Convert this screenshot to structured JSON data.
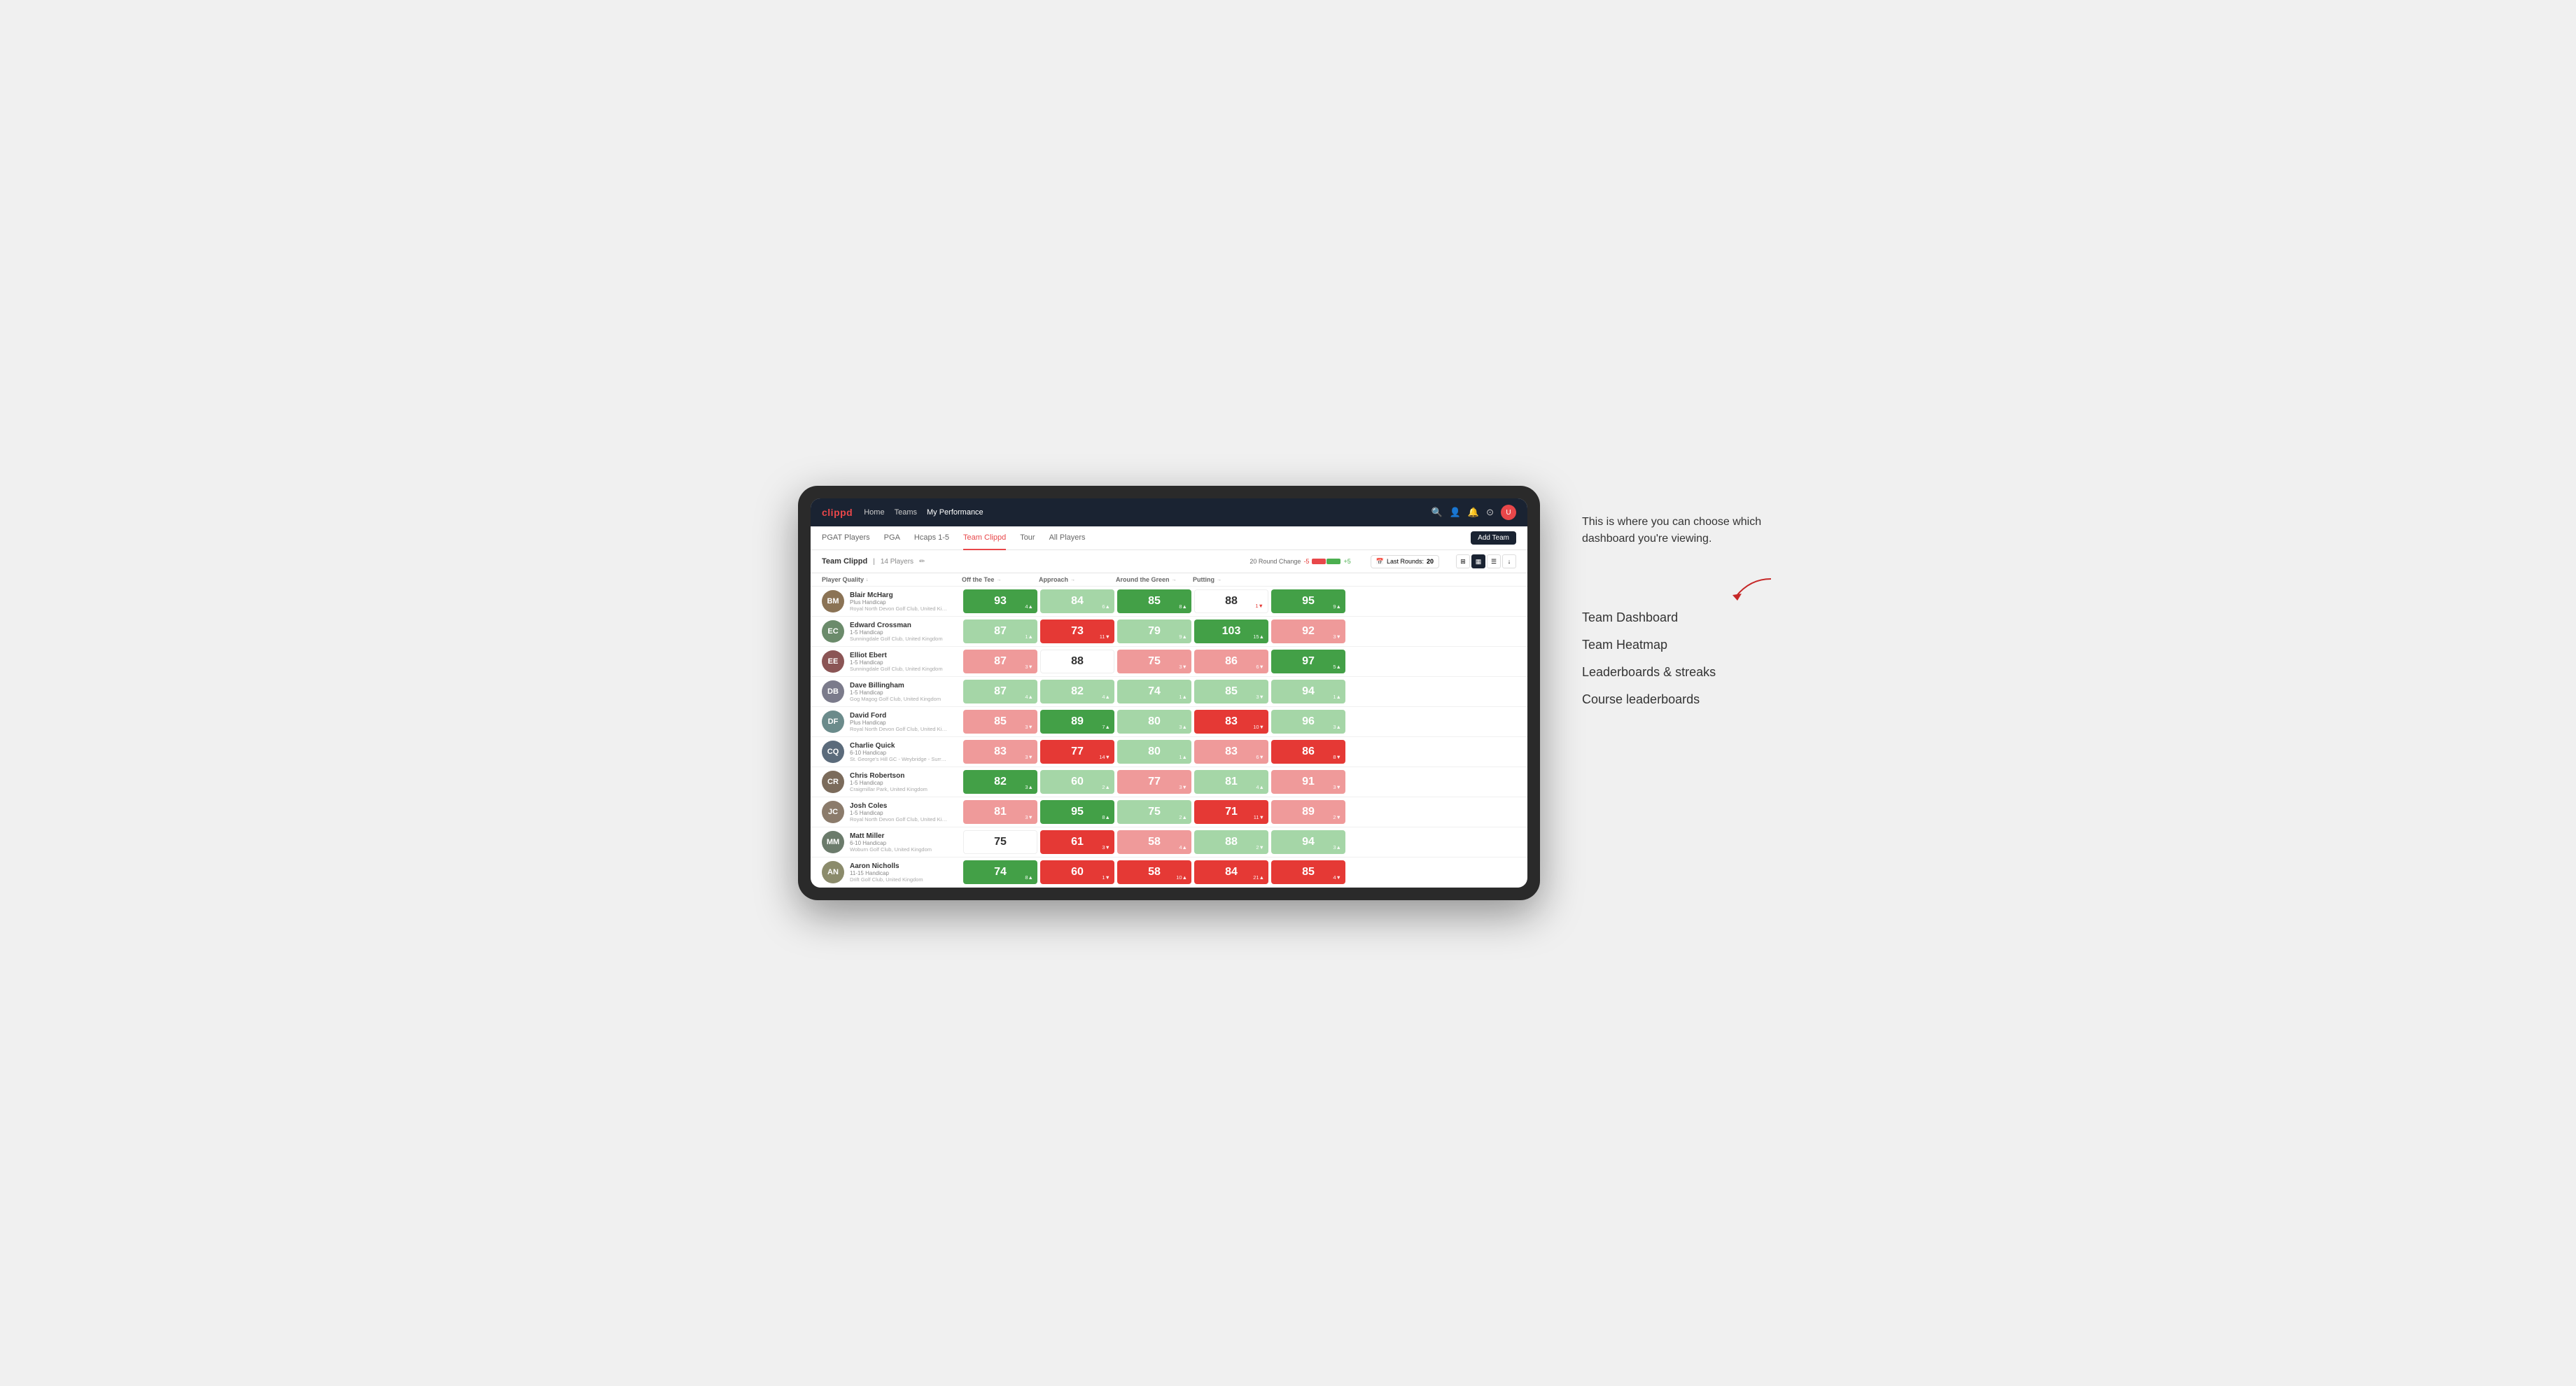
{
  "annotation": {
    "intro_text": "This is where you can choose which dashboard you're viewing.",
    "menu_items": [
      "Team Dashboard",
      "Team Heatmap",
      "Leaderboards & streaks",
      "Course leaderboards"
    ]
  },
  "nav": {
    "logo": "clippd",
    "links": [
      "Home",
      "Teams",
      "My Performance"
    ],
    "active_link": "My Performance"
  },
  "sub_nav": {
    "links": [
      "PGAT Players",
      "PGA",
      "Hcaps 1-5",
      "Team Clippd",
      "Tour",
      "All Players"
    ],
    "active_link": "Team Clippd",
    "add_team_label": "Add Team"
  },
  "team_bar": {
    "name": "Team Clippd",
    "count": "14 Players",
    "round_change_label": "20 Round Change",
    "change_neg": "-5",
    "change_pos": "+5",
    "last_rounds_label": "Last Rounds:",
    "last_rounds_value": "20"
  },
  "table": {
    "headers": [
      "Player Quality ↓",
      "Off the Tee →",
      "Approach →",
      "Around the Green →",
      "Putting →"
    ],
    "rows": [
      {
        "name": "Blair McHarg",
        "handicap": "Plus Handicap",
        "club": "Royal North Devon Golf Club, United Kingdom",
        "initials": "BM",
        "color": "#8B7355",
        "scores": [
          {
            "value": "93",
            "change": "4▲",
            "bg": "green-dark",
            "text": "colored",
            "change_dir": "up"
          },
          {
            "value": "84",
            "change": "6▲",
            "bg": "green-light",
            "text": "colored",
            "change_dir": "up"
          },
          {
            "value": "85",
            "change": "8▲",
            "bg": "green-dark",
            "text": "colored",
            "change_dir": "up"
          },
          {
            "value": "88",
            "change": "1▼",
            "bg": "white",
            "text": "white",
            "change_dir": "down"
          },
          {
            "value": "95",
            "change": "9▲",
            "bg": "green-dark",
            "text": "colored",
            "change_dir": "up"
          }
        ]
      },
      {
        "name": "Edward Crossman",
        "handicap": "1-5 Handicap",
        "club": "Sunningdale Golf Club, United Kingdom",
        "initials": "EC",
        "color": "#6B8B6B",
        "scores": [
          {
            "value": "87",
            "change": "1▲",
            "bg": "green-light",
            "text": "colored",
            "change_dir": "up"
          },
          {
            "value": "73",
            "change": "11▼",
            "bg": "red-dark",
            "text": "colored",
            "change_dir": "down"
          },
          {
            "value": "79",
            "change": "9▲",
            "bg": "green-light",
            "text": "colored",
            "change_dir": "up"
          },
          {
            "value": "103",
            "change": "15▲",
            "bg": "green-dark",
            "text": "colored",
            "change_dir": "up"
          },
          {
            "value": "92",
            "change": "3▼",
            "bg": "red-light",
            "text": "colored",
            "change_dir": "down"
          }
        ]
      },
      {
        "name": "Elliot Ebert",
        "handicap": "1-5 Handicap",
        "club": "Sunningdale Golf Club, United Kingdom",
        "initials": "EE",
        "color": "#8B5555",
        "scores": [
          {
            "value": "87",
            "change": "3▼",
            "bg": "red-light",
            "text": "colored",
            "change_dir": "down"
          },
          {
            "value": "88",
            "change": "",
            "bg": "white",
            "text": "white",
            "change_dir": ""
          },
          {
            "value": "75",
            "change": "3▼",
            "bg": "red-light",
            "text": "colored",
            "change_dir": "down"
          },
          {
            "value": "86",
            "change": "6▼",
            "bg": "red-light",
            "text": "colored",
            "change_dir": "down"
          },
          {
            "value": "97",
            "change": "5▲",
            "bg": "green-dark",
            "text": "colored",
            "change_dir": "up"
          }
        ]
      },
      {
        "name": "Dave Billingham",
        "handicap": "1-5 Handicap",
        "club": "Gog Magog Golf Club, United Kingdom",
        "initials": "DB",
        "color": "#7B7B8B",
        "scores": [
          {
            "value": "87",
            "change": "4▲",
            "bg": "green-light",
            "text": "colored",
            "change_dir": "up"
          },
          {
            "value": "82",
            "change": "4▲",
            "bg": "green-light",
            "text": "colored",
            "change_dir": "up"
          },
          {
            "value": "74",
            "change": "1▲",
            "bg": "green-light",
            "text": "colored",
            "change_dir": "up"
          },
          {
            "value": "85",
            "change": "3▼",
            "bg": "green-light",
            "text": "colored",
            "change_dir": "down"
          },
          {
            "value": "94",
            "change": "1▲",
            "bg": "green-light",
            "text": "colored",
            "change_dir": "up"
          }
        ]
      },
      {
        "name": "David Ford",
        "handicap": "Plus Handicap",
        "club": "Royal North Devon Golf Club, United Kingdom",
        "initials": "DF",
        "color": "#6B8B8B",
        "scores": [
          {
            "value": "85",
            "change": "3▼",
            "bg": "red-light",
            "text": "colored",
            "change_dir": "down"
          },
          {
            "value": "89",
            "change": "7▲",
            "bg": "green-dark",
            "text": "colored",
            "change_dir": "up"
          },
          {
            "value": "80",
            "change": "3▲",
            "bg": "green-light",
            "text": "colored",
            "change_dir": "up"
          },
          {
            "value": "83",
            "change": "10▼",
            "bg": "red-dark",
            "text": "colored",
            "change_dir": "down"
          },
          {
            "value": "96",
            "change": "3▲",
            "bg": "green-light",
            "text": "colored",
            "change_dir": "up"
          }
        ]
      },
      {
        "name": "Charlie Quick",
        "handicap": "6-10 Handicap",
        "club": "St. George's Hill GC - Weybridge - Surrey, Uni...",
        "initials": "CQ",
        "color": "#5B6B7B",
        "scores": [
          {
            "value": "83",
            "change": "3▼",
            "bg": "red-light",
            "text": "colored",
            "change_dir": "down"
          },
          {
            "value": "77",
            "change": "14▼",
            "bg": "red-dark",
            "text": "colored",
            "change_dir": "down"
          },
          {
            "value": "80",
            "change": "1▲",
            "bg": "green-light",
            "text": "colored",
            "change_dir": "up"
          },
          {
            "value": "83",
            "change": "6▼",
            "bg": "red-light",
            "text": "colored",
            "change_dir": "down"
          },
          {
            "value": "86",
            "change": "8▼",
            "bg": "red-dark",
            "text": "colored",
            "change_dir": "down"
          }
        ]
      },
      {
        "name": "Chris Robertson",
        "handicap": "1-5 Handicap",
        "club": "Craigmillar Park, United Kingdom",
        "initials": "CR",
        "color": "#7B6B5B",
        "scores": [
          {
            "value": "82",
            "change": "3▲",
            "bg": "green-dark",
            "text": "colored",
            "change_dir": "up"
          },
          {
            "value": "60",
            "change": "2▲",
            "bg": "green-light",
            "text": "colored",
            "change_dir": "up"
          },
          {
            "value": "77",
            "change": "3▼",
            "bg": "red-light",
            "text": "colored",
            "change_dir": "down"
          },
          {
            "value": "81",
            "change": "4▲",
            "bg": "green-light",
            "text": "colored",
            "change_dir": "up"
          },
          {
            "value": "91",
            "change": "3▼",
            "bg": "red-light",
            "text": "colored",
            "change_dir": "down"
          }
        ]
      },
      {
        "name": "Josh Coles",
        "handicap": "1-5 Handicap",
        "club": "Royal North Devon Golf Club, United Kingdom",
        "initials": "JC",
        "color": "#8B7B6B",
        "scores": [
          {
            "value": "81",
            "change": "3▼",
            "bg": "red-light",
            "text": "colored",
            "change_dir": "down"
          },
          {
            "value": "95",
            "change": "8▲",
            "bg": "green-dark",
            "text": "colored",
            "change_dir": "up"
          },
          {
            "value": "75",
            "change": "2▲",
            "bg": "green-light",
            "text": "colored",
            "change_dir": "up"
          },
          {
            "value": "71",
            "change": "11▼",
            "bg": "red-dark",
            "text": "colored",
            "change_dir": "down"
          },
          {
            "value": "89",
            "change": "2▼",
            "bg": "red-light",
            "text": "colored",
            "change_dir": "down"
          }
        ]
      },
      {
        "name": "Matt Miller",
        "handicap": "6-10 Handicap",
        "club": "Woburn Golf Club, United Kingdom",
        "initials": "MM",
        "color": "#6B7B6B",
        "scores": [
          {
            "value": "75",
            "change": "",
            "bg": "white",
            "text": "white",
            "change_dir": ""
          },
          {
            "value": "61",
            "change": "3▼",
            "bg": "red-dark",
            "text": "colored",
            "change_dir": "down"
          },
          {
            "value": "58",
            "change": "4▲",
            "bg": "red-light",
            "text": "colored",
            "change_dir": "up"
          },
          {
            "value": "88",
            "change": "2▼",
            "bg": "green-light",
            "text": "colored",
            "change_dir": "down"
          },
          {
            "value": "94",
            "change": "3▲",
            "bg": "green-light",
            "text": "colored",
            "change_dir": "up"
          }
        ]
      },
      {
        "name": "Aaron Nicholls",
        "handicap": "11-15 Handicap",
        "club": "Drift Golf Club, United Kingdom",
        "initials": "AN",
        "color": "#8B8B6B",
        "scores": [
          {
            "value": "74",
            "change": "8▲",
            "bg": "green-dark",
            "text": "colored",
            "change_dir": "up"
          },
          {
            "value": "60",
            "change": "1▼",
            "bg": "red-dark",
            "text": "colored",
            "change_dir": "down"
          },
          {
            "value": "58",
            "change": "10▲",
            "bg": "red-dark",
            "text": "colored",
            "change_dir": "up"
          },
          {
            "value": "84",
            "change": "21▲",
            "bg": "red-dark",
            "text": "colored",
            "change_dir": "up"
          },
          {
            "value": "85",
            "change": "4▼",
            "bg": "red-dark",
            "text": "colored",
            "change_dir": "down"
          }
        ]
      }
    ]
  }
}
